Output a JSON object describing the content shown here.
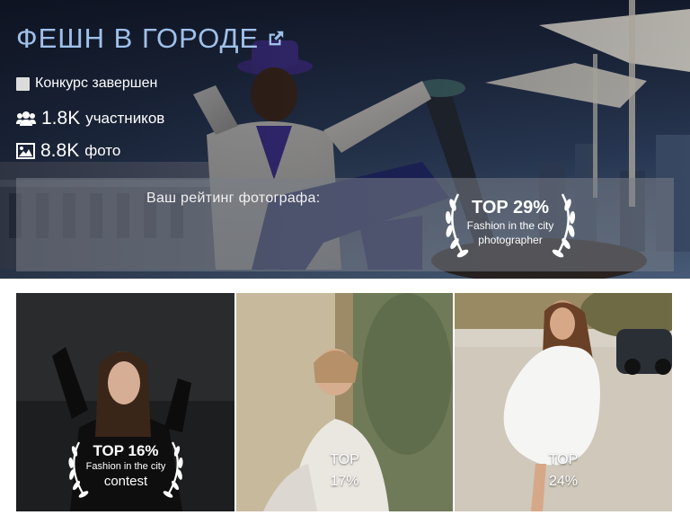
{
  "contest": {
    "title": "ФЕШН В ГОРОДЕ",
    "status": "Конкурс завершен",
    "participants_count": "1.8K",
    "participants_label": "участников",
    "photos_count": "8.8K",
    "photos_label": "фото"
  },
  "icons": {
    "external_link": "external-link-icon",
    "status": "checkbox-icon",
    "participants": "users-icon",
    "photos": "image-icon",
    "award": "laurel-icon"
  },
  "rating": {
    "label": "Ваш рейтинг фотографа:",
    "badge_top": "TOP 29%",
    "badge_line1": "Fashion in the city",
    "badge_line2": "photographer"
  },
  "gallery": [
    {
      "badge_top": "TOP 16%",
      "badge_line1": "Fashion in the city",
      "badge_line2": "contest"
    },
    {
      "top_label": "TOP",
      "percent": "17%"
    },
    {
      "top_label": "TOP",
      "percent": "24%"
    }
  ],
  "colors": {
    "title": "#9fc0ea",
    "rating_strip": "#787d87"
  }
}
